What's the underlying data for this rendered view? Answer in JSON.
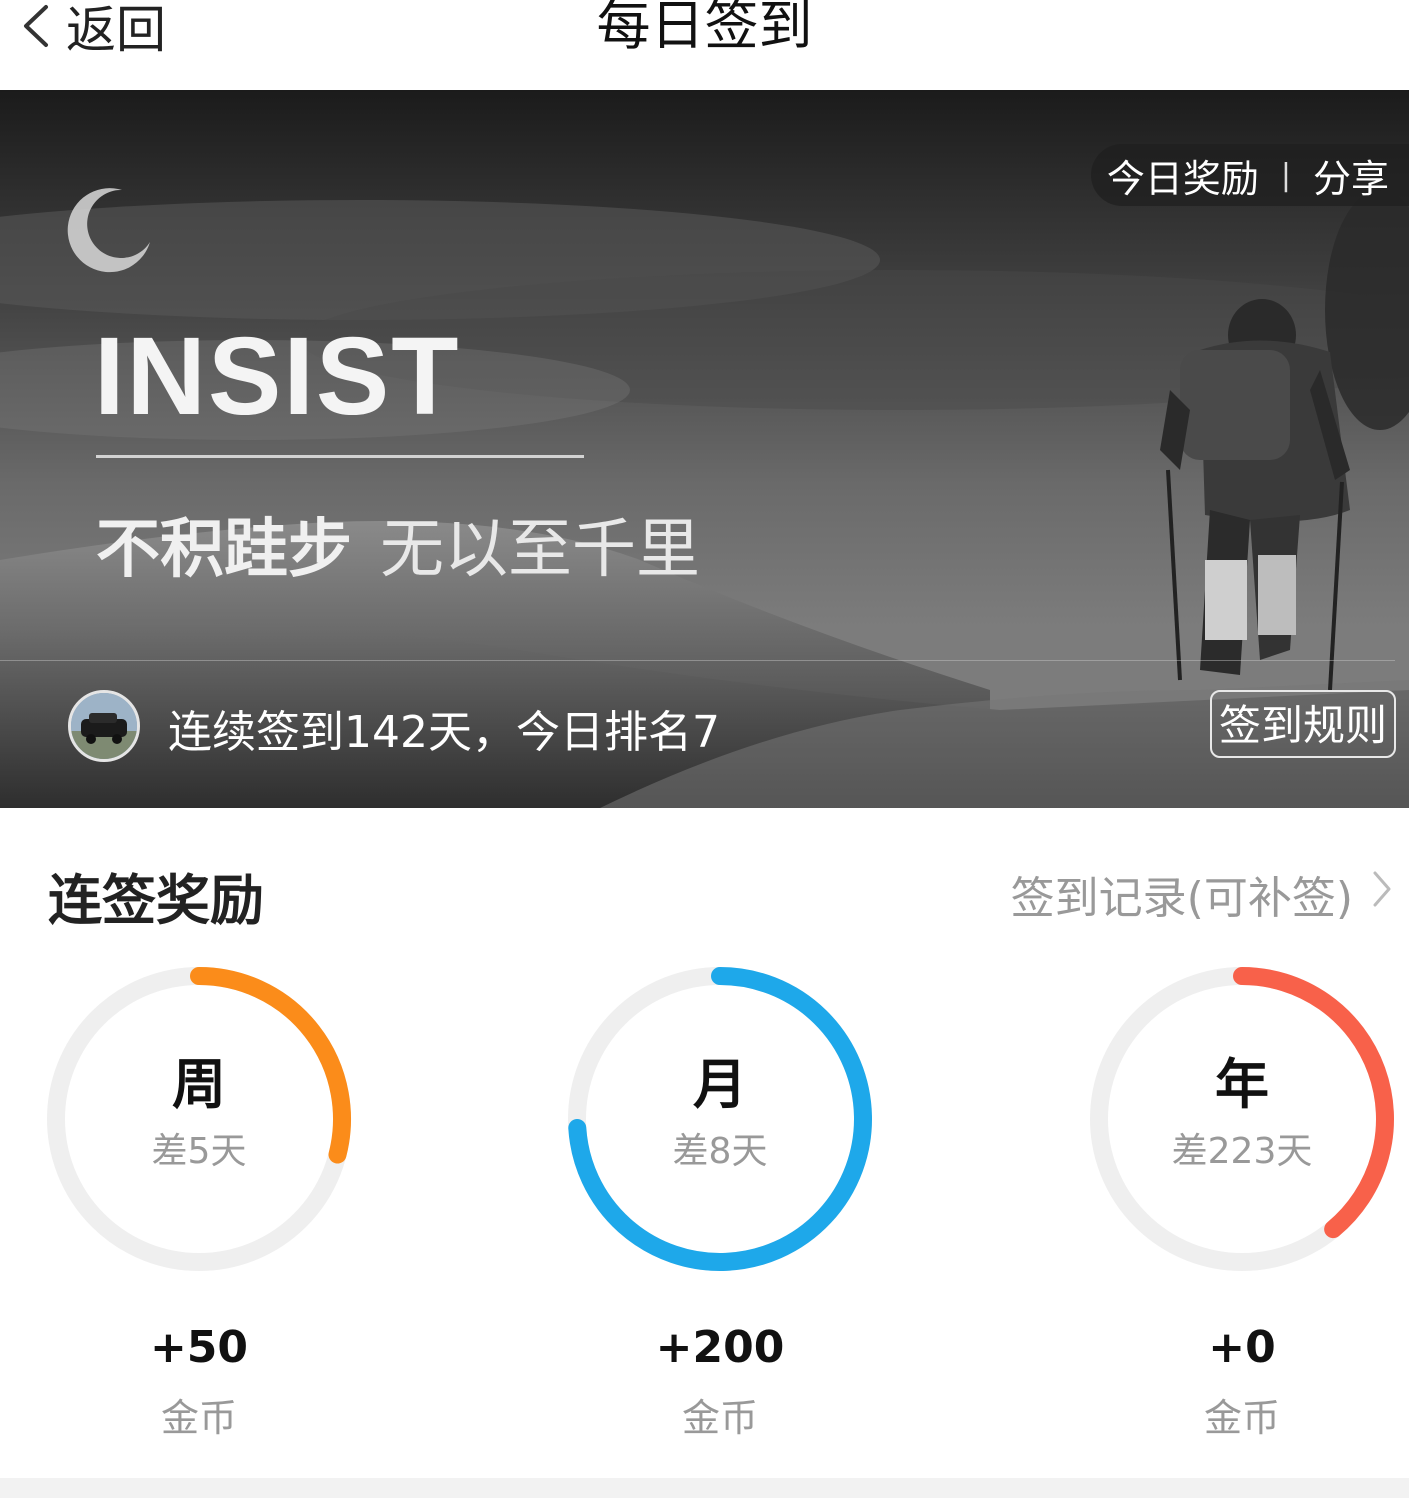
{
  "header": {
    "back_label": "返回",
    "title": "每日签到"
  },
  "banner": {
    "today_reward_label": "今日奖励",
    "separator": "|",
    "share_label": "分享",
    "headline": "INSIST",
    "slogan_bold": "不积跬步",
    "slogan_thin": "无以至千里",
    "streak_text": "连续签到142天，今日排名7",
    "rules_button_label": "签到规则"
  },
  "rewards_section": {
    "title": "连签奖励",
    "records_link_label": "签到记录(可补签)",
    "items": [
      {
        "period": "周",
        "remaining": "差5天",
        "coins": "+50",
        "unit": "金币",
        "progress": 0.29,
        "color": "#fb8c1a"
      },
      {
        "period": "月",
        "remaining": "差8天",
        "coins": "+200",
        "unit": "金币",
        "progress": 0.74,
        "color": "#1ea8ea"
      },
      {
        "period": "年",
        "remaining": "差223天",
        "coins": "+0",
        "unit": "金币",
        "progress": 0.39,
        "color": "#f8614a"
      }
    ]
  },
  "colors": {
    "ring_track": "#efefef",
    "muted_text": "#999999"
  }
}
